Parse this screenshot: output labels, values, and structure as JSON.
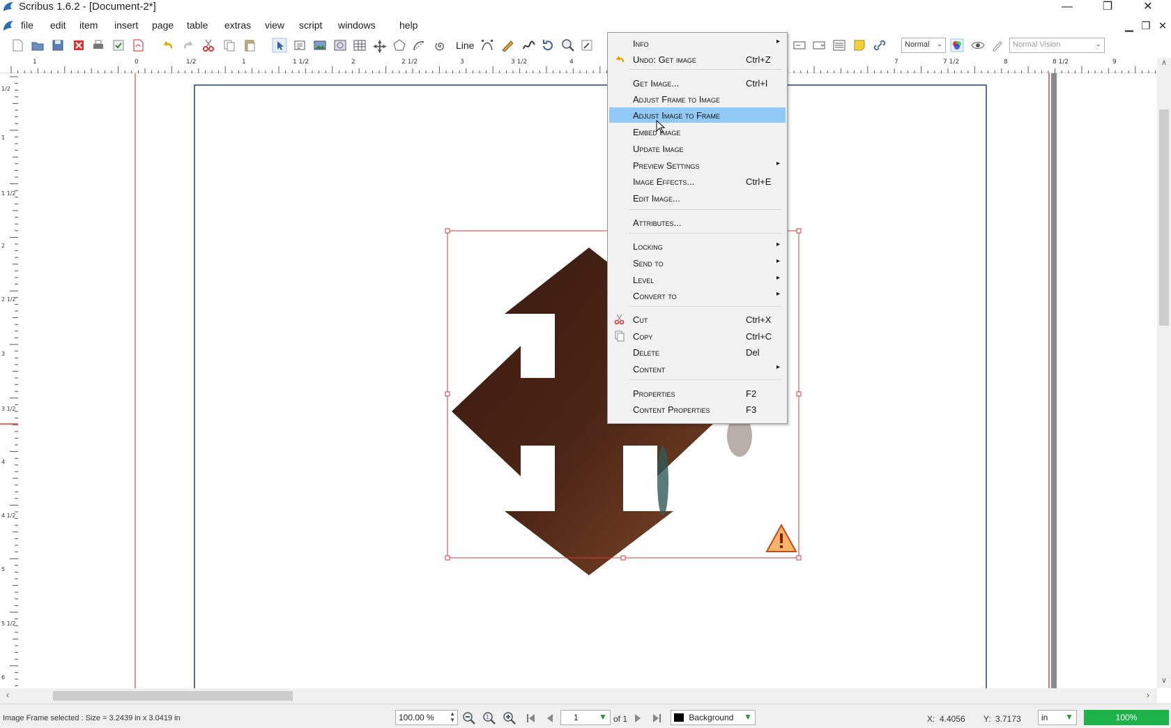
{
  "window": {
    "title": "Scribus 1.6.2 - [Document-2*]",
    "minimize": "—",
    "restore": "❐",
    "close": "✕"
  },
  "menubar": {
    "items": [
      "file",
      "edit",
      "item",
      "insert",
      "page",
      "table",
      "extras",
      "view",
      "script",
      "windows",
      "help"
    ]
  },
  "toolbar": {
    "line_label": "Line",
    "mode_select": "Normal",
    "vision_select": "Normal Vision"
  },
  "context_menu": {
    "items": [
      {
        "label": "Info",
        "shortcut": "",
        "submenu": true
      },
      {
        "label": "Undo: Get image",
        "shortcut": "Ctrl+Z",
        "submenu": false
      },
      {
        "label": "Get Image...",
        "shortcut": "Ctrl+I",
        "submenu": false
      },
      {
        "label": "Adjust Frame to Image",
        "shortcut": "",
        "submenu": false
      },
      {
        "label": "Adjust Image to Frame",
        "shortcut": "",
        "submenu": false,
        "highlighted": true
      },
      {
        "label": "Embed Image",
        "shortcut": "",
        "submenu": false
      },
      {
        "label": "Update Image",
        "shortcut": "",
        "submenu": false
      },
      {
        "label": "Preview Settings",
        "shortcut": "",
        "submenu": true
      },
      {
        "label": "Image Effects...",
        "shortcut": "Ctrl+E",
        "submenu": false
      },
      {
        "label": "Edit Image...",
        "shortcut": "",
        "submenu": false
      },
      {
        "label": "Attributes...",
        "shortcut": "",
        "submenu": false
      },
      {
        "label": "Locking",
        "shortcut": "",
        "submenu": true
      },
      {
        "label": "Send to",
        "shortcut": "",
        "submenu": true
      },
      {
        "label": "Level",
        "shortcut": "",
        "submenu": true
      },
      {
        "label": "Convert to",
        "shortcut": "",
        "submenu": true
      },
      {
        "label": "Cut",
        "shortcut": "Ctrl+X",
        "submenu": false
      },
      {
        "label": "Copy",
        "shortcut": "Ctrl+C",
        "submenu": false
      },
      {
        "label": "Delete",
        "shortcut": "Del",
        "submenu": false
      },
      {
        "label": "Content",
        "shortcut": "",
        "submenu": true
      },
      {
        "label": "Properties",
        "shortcut": "F2",
        "submenu": false
      },
      {
        "label": "Content Properties",
        "shortcut": "F3",
        "submenu": false
      }
    ]
  },
  "rulers": {
    "h_labels": [
      "1",
      "0",
      "1/2",
      "1",
      "1 1/2",
      "2",
      "2 1/2",
      "3",
      "3 1/2",
      "4",
      "7",
      "7 1/2",
      "8",
      "8 1/2",
      "9"
    ],
    "v_labels": [
      "1/2",
      "1",
      "1 1/2",
      "2",
      "2 1/2",
      "3",
      "3 1/2",
      "4",
      "4 1/2",
      "5",
      "5 1/2",
      "6"
    ]
  },
  "statusbar": {
    "status_text": "Image Frame selected : Size = 3.2439 in x 3.0419 in",
    "zoom_value": "100.00 %",
    "page_value": "1",
    "page_of": "of 1",
    "layer_value": "Background",
    "x_label": "X:",
    "x_value": "4.4056",
    "y_label": "Y:",
    "y_value": "3.7173",
    "unit_value": "in",
    "zoom_percent": "100%"
  },
  "colors": {
    "accent": "#91c9f7",
    "page_margin": "#1f3e8a",
    "bleed_line": "#e36b6b",
    "frame_outline": "#d33b3b",
    "zoom_badge": "#1db34a"
  }
}
